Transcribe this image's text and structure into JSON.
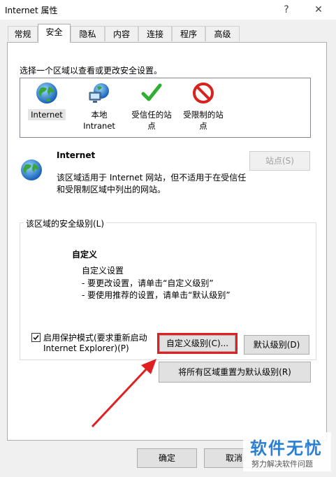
{
  "window": {
    "title": "Internet 属性",
    "help_glyph": "?",
    "close_glyph": "✕"
  },
  "tabs": [
    "常规",
    "安全",
    "隐私",
    "内容",
    "连接",
    "程序",
    "高级"
  ],
  "active_tab": "安全",
  "zones": {
    "prompt": "选择一个区域以查看或更改安全设置。",
    "items": [
      {
        "label": "Internet",
        "icon": "globe-icon"
      },
      {
        "label": "本地\nIntranet",
        "icon": "local-intranet-icon"
      },
      {
        "label": "受信任的站\n点",
        "icon": "trusted-check-icon"
      },
      {
        "label": "受限制的站\n点",
        "icon": "restricted-icon"
      }
    ]
  },
  "zone_info": {
    "name": "Internet",
    "desc_line1": "该区域适用于 Internet 网站，但不适用于在受信任",
    "desc_line2": "和受限制区域中列出的网站。",
    "sites_button": "站点(S)"
  },
  "security_level": {
    "group_label": "该区域的安全级别(L)",
    "level_name": "自定义",
    "detail_line1": "自定义设置",
    "detail_line2": "- 要更改设置，请单击“自定义级别”",
    "detail_line3": "- 要使用推荐的设置，请单击“默认级别”",
    "protected_mode_line1": "启用保护模式(要求重新启动",
    "protected_mode_line2": "Internet Explorer)(P)",
    "protected_mode_checked": true,
    "custom_level_button": "自定义级别(C)...",
    "default_level_button": "默认级别(D)",
    "reset_all_button": "将所有区域重置为默认级别(R)"
  },
  "footer": {
    "ok_button": "确定",
    "cancel_button": "取消"
  },
  "watermark": {
    "brand": "软件无忧",
    "tagline": "努力解决软件问题"
  },
  "colors": {
    "annotation_red": "#e02020",
    "checkmark_green": "#2fae2f",
    "restricted_red": "#d8221f",
    "watermark_blue": "#2a7fd4"
  }
}
